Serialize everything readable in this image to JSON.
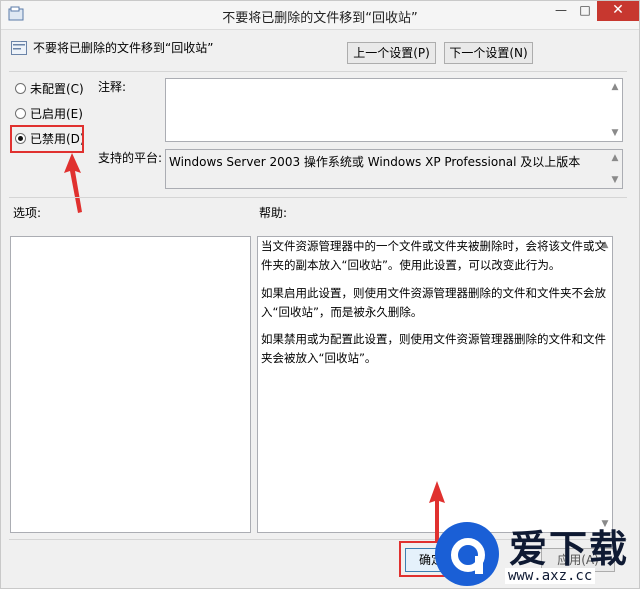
{
  "window": {
    "title": "不要将已删除的文件移到“回收站”",
    "min_label": "—",
    "max_label": "□",
    "close_label": "✕"
  },
  "header": {
    "policy_name": "不要将已删除的文件移到“回收站”",
    "prev_label": "上一个设置(P)",
    "next_label": "下一个设置(N)"
  },
  "state": {
    "options": [
      {
        "label": "未配置(C)",
        "checked": false
      },
      {
        "label": "已启用(E)",
        "checked": false
      },
      {
        "label": "已禁用(D)",
        "checked": true
      }
    ]
  },
  "comment": {
    "label": "注释:",
    "value": ""
  },
  "platform": {
    "label": "支持的平台:",
    "value": "Windows Server 2003 操作系统或 Windows XP Professional 及以上版本"
  },
  "options_section": {
    "label": "选项:"
  },
  "help_section": {
    "label": "帮助:",
    "paragraphs": [
      "当文件资源管理器中的一个文件或文件夹被删除时，会将该文件或文件夹的副本放入“回收站”。使用此设置，可以改变此行为。",
      "如果启用此设置，则使用文件资源管理器删除的文件和文件夹不会放入“回收站”，而是被永久删除。",
      "如果禁用或为配置此设置，则使用文件资源管理器删除的文件和文件夹会被放入“回收站”。"
    ]
  },
  "footer": {
    "ok_label": "确定",
    "apply_label": "应用(A)"
  },
  "watermark": {
    "brand": "爱下载",
    "url": "www.axz.cc"
  },
  "colors": {
    "highlight_red": "#e0312f",
    "close_red": "#c7372f",
    "logo_blue": "#1a5fd6"
  }
}
